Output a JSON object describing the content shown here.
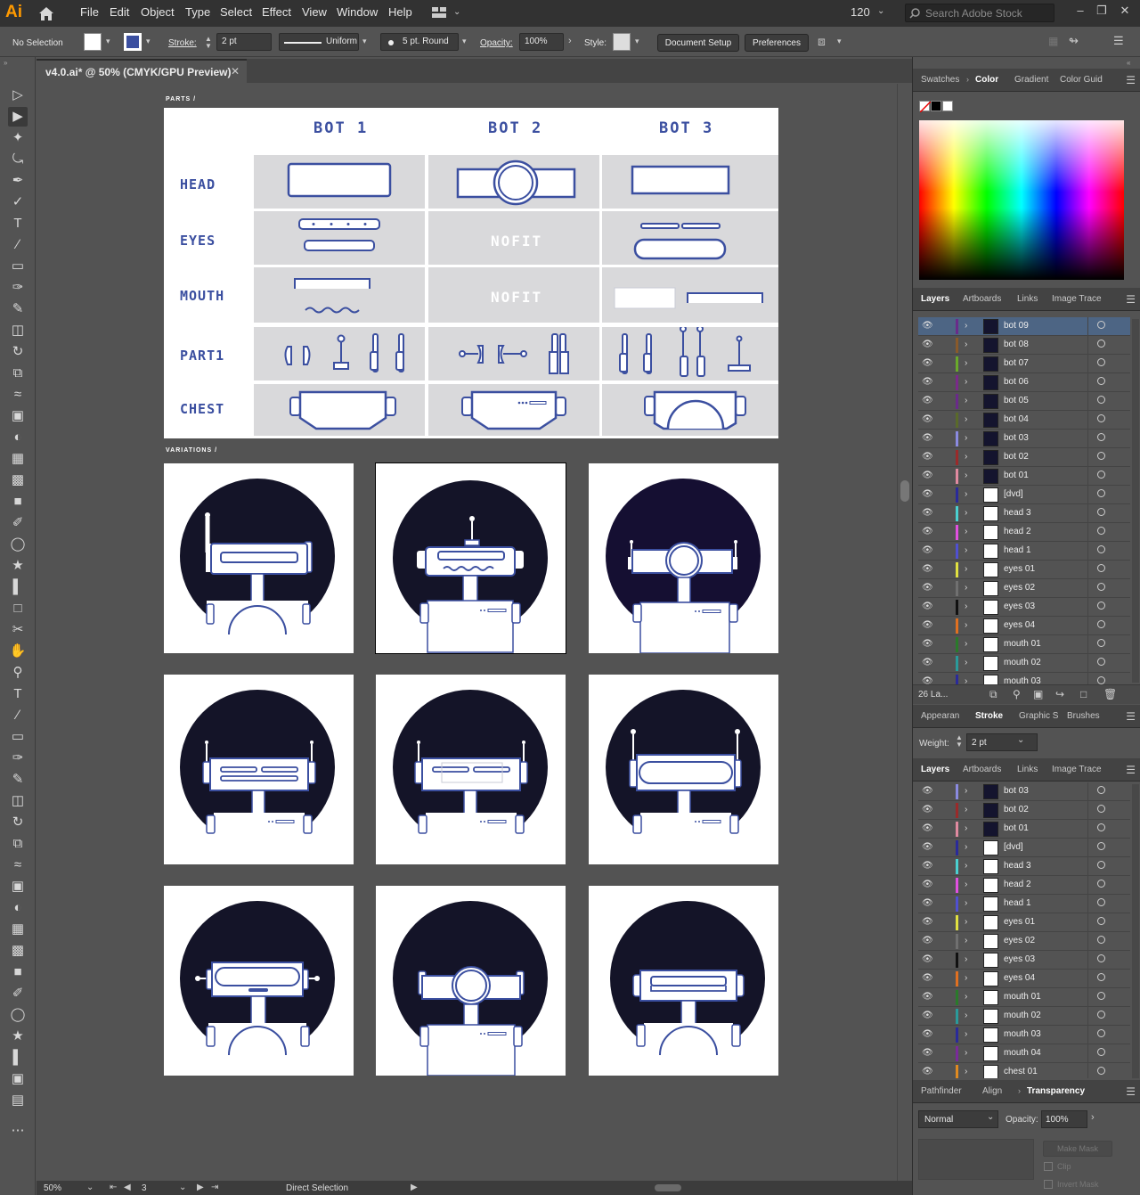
{
  "app": {
    "logo": "Ai"
  },
  "menu": [
    "File",
    "Edit",
    "Object",
    "Type",
    "Select",
    "Effect",
    "View",
    "Window",
    "Help"
  ],
  "workspace_zoom": "120",
  "search": {
    "placeholder": "Search Adobe Stock"
  },
  "control_bar": {
    "selection": "No Selection",
    "stroke_label": "Stroke:",
    "stroke_weight": "2 pt",
    "profile": "Uniform",
    "brush": "5 pt. Round",
    "opacity_label": "Opacity:",
    "opacity": "100%",
    "style_label": "Style:",
    "document_setup": "Document Setup",
    "preferences": "Preferences"
  },
  "document": {
    "tab_title": "v4.0.ai* @ 50% (CMYK/GPU Preview)"
  },
  "status": {
    "zoom": "50%",
    "artboard": "3",
    "tool": "Direct Selection"
  },
  "parts": {
    "section_label": "PARTS /",
    "columns": [
      "BOT 1",
      "BOT 2",
      "BOT 3"
    ],
    "rows": [
      "HEAD",
      "EYES",
      "MOUTH",
      "PART1",
      "CHEST"
    ],
    "nofit": "NOFIT"
  },
  "variations": {
    "section_label": "VARIATIONS /"
  },
  "color_panel": {
    "tabs": [
      "Swatches",
      "Color",
      "Gradient",
      "Color Guid"
    ],
    "active": "Color"
  },
  "layers_panel_top": {
    "tabs": [
      "Layers",
      "Artboards",
      "Links",
      "Image Trace"
    ],
    "active": "Layers",
    "footer_count": "26 La...",
    "layers": [
      {
        "name": "bot 09",
        "color": "#6a2b8a",
        "thumb": "bot",
        "selected": true
      },
      {
        "name": "bot 08",
        "color": "#8a5a2a",
        "thumb": "bot"
      },
      {
        "name": "bot 07",
        "color": "#6aaa2a",
        "thumb": "bot"
      },
      {
        "name": "bot 06",
        "color": "#7a2a8a",
        "thumb": "bot"
      },
      {
        "name": "bot 05",
        "color": "#6a2a8a",
        "thumb": "bot"
      },
      {
        "name": "bot 04",
        "color": "#5a6a2a",
        "thumb": "bot"
      },
      {
        "name": "bot 03",
        "color": "#8a8ae0",
        "thumb": "bot"
      },
      {
        "name": "bot 02",
        "color": "#9a2a2a",
        "thumb": "bot"
      },
      {
        "name": "bot 01",
        "color": "#e08aa0",
        "thumb": "bot"
      },
      {
        "name": "[dvd]",
        "color": "#2a2a9a",
        "thumb": "plain"
      },
      {
        "name": "head 3",
        "color": "#4ad0d0",
        "thumb": "plain"
      },
      {
        "name": "head 2",
        "color": "#e050e0",
        "thumb": "plain"
      },
      {
        "name": "head 1",
        "color": "#5050d0",
        "thumb": "plain"
      },
      {
        "name": "eyes 01",
        "color": "#e0e040",
        "thumb": "plain"
      },
      {
        "name": "eyes 02",
        "color": "#707070",
        "thumb": "plain"
      },
      {
        "name": "eyes 03",
        "color": "#111111",
        "thumb": "plain"
      },
      {
        "name": "eyes 04",
        "color": "#e07020",
        "thumb": "plain"
      },
      {
        "name": "mouth 01",
        "color": "#2a7a2a",
        "thumb": "plain"
      },
      {
        "name": "mouth 02",
        "color": "#2a9a9a",
        "thumb": "plain"
      },
      {
        "name": "mouth 03",
        "color": "#2a2a9a",
        "thumb": "plain"
      }
    ]
  },
  "stroke_panel": {
    "tabs": [
      "Appearan",
      "Stroke",
      "Graphic S",
      "Brushes"
    ],
    "active": "Stroke",
    "weight_label": "Weight:",
    "weight": "2 pt"
  },
  "layers_panel_bottom": {
    "tabs": [
      "Layers",
      "Artboards",
      "Links",
      "Image Trace"
    ],
    "active": "Layers",
    "layers": [
      {
        "name": "bot 03",
        "color": "#8a8ae0",
        "thumb": "bot"
      },
      {
        "name": "bot 02",
        "color": "#9a2a2a",
        "thumb": "bot"
      },
      {
        "name": "bot 01",
        "color": "#e08aa0",
        "thumb": "bot"
      },
      {
        "name": "[dvd]",
        "color": "#2a2a9a",
        "thumb": "plain"
      },
      {
        "name": "head 3",
        "color": "#4ad0d0",
        "thumb": "plain"
      },
      {
        "name": "head 2",
        "color": "#e050e0",
        "thumb": "plain"
      },
      {
        "name": "head 1",
        "color": "#5050d0",
        "thumb": "plain"
      },
      {
        "name": "eyes 01",
        "color": "#e0e040",
        "thumb": "plain"
      },
      {
        "name": "eyes 02",
        "color": "#707070",
        "thumb": "plain"
      },
      {
        "name": "eyes 03",
        "color": "#111111",
        "thumb": "plain"
      },
      {
        "name": "eyes 04",
        "color": "#e07020",
        "thumb": "plain"
      },
      {
        "name": "mouth 01",
        "color": "#2a7a2a",
        "thumb": "plain"
      },
      {
        "name": "mouth 02",
        "color": "#2a9a9a",
        "thumb": "plain"
      },
      {
        "name": "mouth 03",
        "color": "#2a2a9a",
        "thumb": "plain"
      },
      {
        "name": "mouth 04",
        "color": "#7a2a9a",
        "thumb": "plain"
      },
      {
        "name": "chest 01",
        "color": "#e08a20",
        "thumb": "plain"
      }
    ]
  },
  "transparency_panel": {
    "tabs": [
      "Pathfinder",
      "Align",
      "Transparency"
    ],
    "active": "Transparency",
    "blend_mode": "Normal",
    "opacity_label": "Opacity:",
    "opacity": "100%",
    "make_mask": "Make Mask",
    "clip": "Clip",
    "invert_mask": "Invert Mask"
  },
  "colors": {
    "bot_blue": "#3b4fa0",
    "bot_bg": "#141428",
    "panel_bg": "#535353"
  }
}
